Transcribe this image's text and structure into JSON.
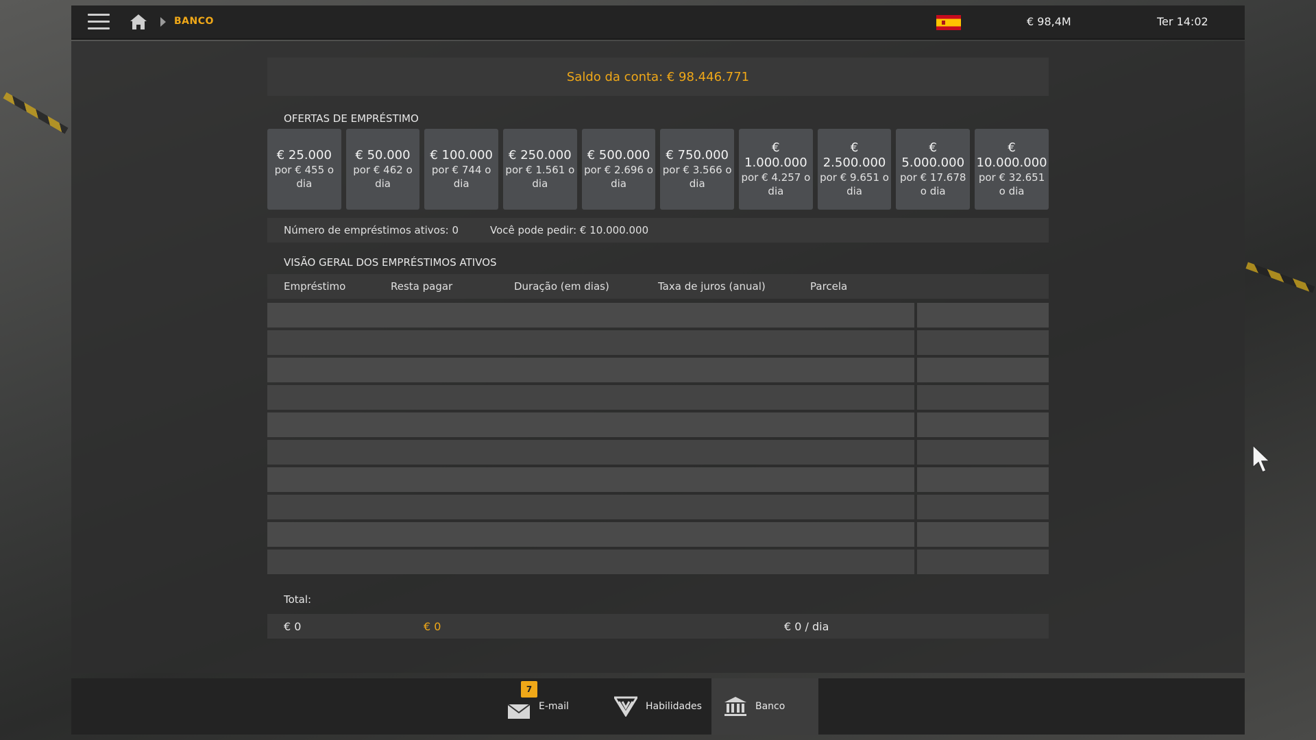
{
  "header": {
    "breadcrumb": "BANCO",
    "money": "€ 98,4M",
    "clock": "Ter 14:02"
  },
  "account": {
    "saldo": "Saldo da conta: € 98.446.771"
  },
  "offers": {
    "title": "OFERTAS DE EMPRÉSTIMO",
    "items": [
      {
        "amount": "€ 25.000",
        "rate": "por € 455 o dia"
      },
      {
        "amount": "€ 50.000",
        "rate": "por € 462 o dia"
      },
      {
        "amount": "€ 100.000",
        "rate": "por € 744 o dia"
      },
      {
        "amount": "€ 250.000",
        "rate": "por € 1.561 o dia"
      },
      {
        "amount": "€ 500.000",
        "rate": "por € 2.696 o dia"
      },
      {
        "amount": "€ 750.000",
        "rate": "por € 3.566 o dia"
      },
      {
        "amount": "€ 1.000.000",
        "rate": "por € 4.257 o dia"
      },
      {
        "amount": "€ 2.500.000",
        "rate": "por € 9.651 o dia"
      },
      {
        "amount": "€ 5.000.000",
        "rate": "por € 17.678 o dia"
      },
      {
        "amount": "€ 10.000.000",
        "rate": "por € 32.651 o dia"
      }
    ]
  },
  "info": {
    "active_loans": "Número de empréstimos ativos: 0",
    "can_request": "Você pode pedir: € 10.000.000"
  },
  "overview": {
    "title": "VISÃO GERAL DOS EMPRÉSTIMOS ATIVOS",
    "columns": [
      "Empréstimo",
      "Resta pagar",
      "Duração (em dias)",
      "Taxa de juros (anual)",
      "Parcela"
    ],
    "rows": []
  },
  "totals": {
    "label": "Total:",
    "loan": "€ 0",
    "remaining": "€ 0",
    "installment": "€ 0 / dia"
  },
  "bottom_nav": {
    "email_label": "E-mail",
    "email_badge": "7",
    "skills_label": "Habilidades",
    "bank_label": "Banco"
  },
  "colors": {
    "accent": "#f0a818",
    "panel": "#393939",
    "offer_tile": "#4c4e51"
  }
}
